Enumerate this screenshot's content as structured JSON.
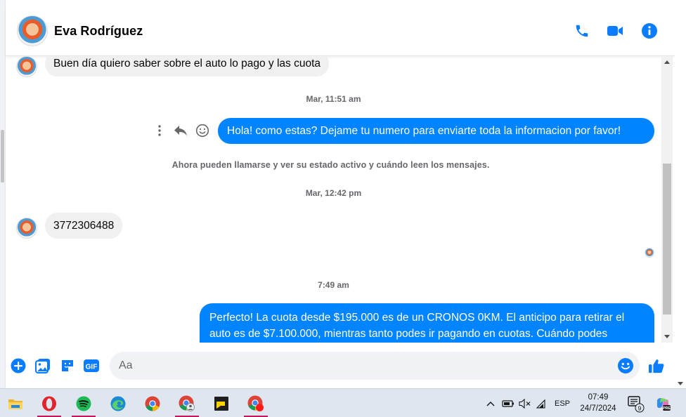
{
  "contact": {
    "name": "Eva Rodríguez"
  },
  "header_icons": [
    "phone-icon",
    "video-camera-icon",
    "info-icon"
  ],
  "messages": [
    {
      "direction": "in",
      "text": "Buen día quiero saber sobre el auto lo pago y las cuota"
    },
    {
      "type": "timestamp",
      "text": "Mar, 11:51 am"
    },
    {
      "direction": "out",
      "text": "Hola! como estas? Dejame tu numero para enviarte toda la informacion por favor!"
    },
    {
      "type": "system",
      "text": "Ahora pueden llamarse y ver su estado activo y cuándo leen los mensajes."
    },
    {
      "type": "timestamp",
      "text": "Mar, 12:42 pm"
    },
    {
      "direction": "in",
      "text": "3772306488"
    },
    {
      "type": "timestamp",
      "text": "7:49 am"
    },
    {
      "direction": "out",
      "line1": "Perfecto! La cuota desde $195.000 es de un CRONOS 0KM. El anticipo para retirar el",
      "line2": "auto es de $7.100.000, mientras tanto podes ir pagando en cuotas. Cuándo podes"
    }
  ],
  "composer": {
    "placeholder": "Aa"
  },
  "taskbar": {
    "apps": [
      "file-explorer",
      "opera",
      "spotify",
      "edge",
      "chrome",
      "chrome-profile",
      "sticky-notes",
      "chrome-notification"
    ],
    "tray": {
      "language": "ESP",
      "time": "07:49",
      "date": "24/7/2024",
      "notification_count": "9"
    }
  },
  "colors": {
    "brand_blue": "#0084ff",
    "incoming_bubble": "#f0f0f0",
    "muted_text": "#65676b"
  }
}
